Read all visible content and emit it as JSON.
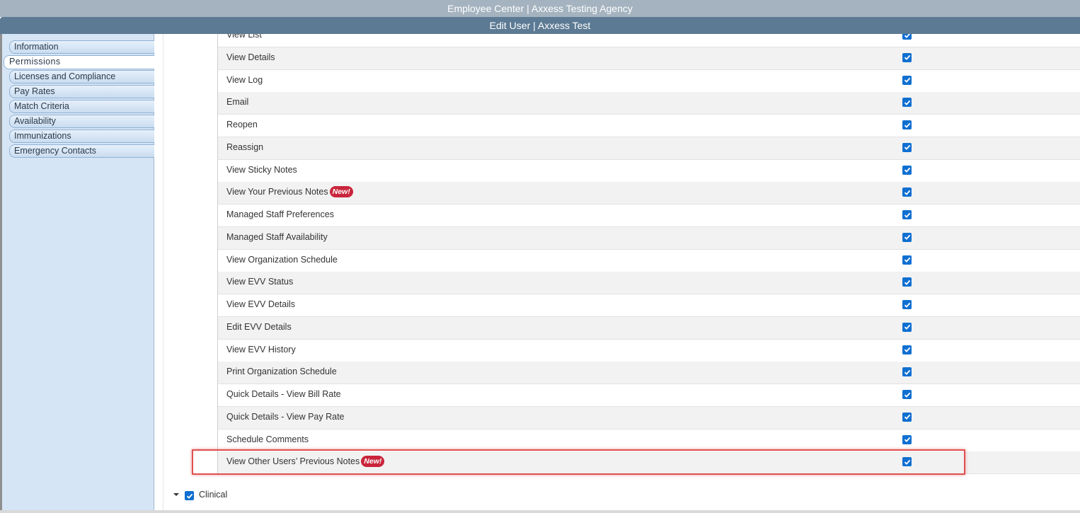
{
  "app": {
    "title": "Employee Center | Axxess Testing Agency"
  },
  "header": {
    "title": "Edit User | Axxess Test"
  },
  "sidebar": {
    "items": [
      {
        "label": "Information",
        "active": false
      },
      {
        "label": "Permissions",
        "active": true
      },
      {
        "label": "Licenses and Compliance",
        "active": false
      },
      {
        "label": "Pay Rates",
        "active": false
      },
      {
        "label": "Match Criteria",
        "active": false
      },
      {
        "label": "Availability",
        "active": false
      },
      {
        "label": "Immunizations",
        "active": false
      },
      {
        "label": "Emergency Contacts",
        "active": false
      }
    ]
  },
  "permissions": {
    "rows": [
      {
        "label": "View List",
        "checked": true
      },
      {
        "label": "View Details",
        "checked": true
      },
      {
        "label": "View Log",
        "checked": true
      },
      {
        "label": "Email",
        "checked": true
      },
      {
        "label": "Reopen",
        "checked": true
      },
      {
        "label": "Reassign",
        "checked": true
      },
      {
        "label": "View Sticky Notes",
        "checked": true
      },
      {
        "label": "View Your Previous Notes",
        "checked": true,
        "badge": "New!"
      },
      {
        "label": "Managed Staff Preferences",
        "checked": true
      },
      {
        "label": "Managed Staff Availability",
        "checked": true
      },
      {
        "label": "View Organization Schedule",
        "checked": true
      },
      {
        "label": "View EVV Status",
        "checked": true
      },
      {
        "label": "View EVV Details",
        "checked": true
      },
      {
        "label": "Edit EVV Details",
        "checked": true
      },
      {
        "label": "View EVV History",
        "checked": true
      },
      {
        "label": "Print Organization Schedule",
        "checked": true
      },
      {
        "label": "Quick Details - View Bill Rate",
        "checked": true
      },
      {
        "label": "Quick Details - View Pay Rate",
        "checked": true
      },
      {
        "label": "Schedule Comments",
        "checked": true
      },
      {
        "label": "View Other Users’ Previous Notes",
        "checked": true,
        "badge": "New!"
      }
    ]
  },
  "section": {
    "label": "Clinical",
    "checked": true,
    "expanded": true
  },
  "colors": {
    "accent": "#0f6fd1",
    "badge": "#c9253c",
    "highlight": "#e05050",
    "header": "#5c7a94",
    "titlebar": "#a4b3bf"
  }
}
